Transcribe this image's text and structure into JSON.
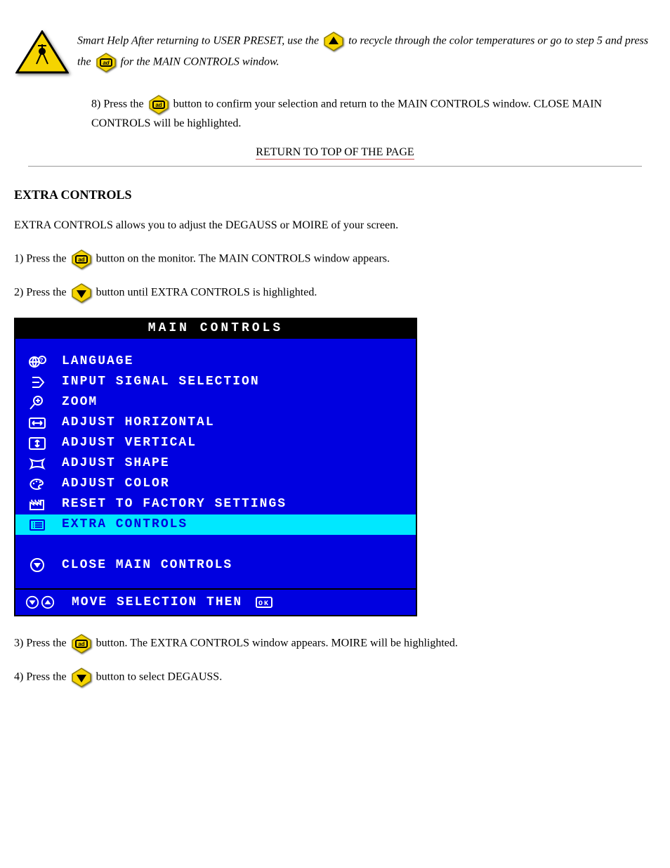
{
  "block1": {
    "smart_help_text_a": "Smart Help After returning to USER PRESET, use the ",
    "smart_help_text_b": " to recycle through the color temperatures or go to step 5 and press the ",
    "smart_help_text_c": " for the MAIN CONTROLS window."
  },
  "para2": {
    "a": "8) Press the ",
    "b": " button to confirm your selection and return to the MAIN CONTROLS window. CLOSE MAIN CONTROLS will be highlighted."
  },
  "center_link": "RETURN TO TOP OF THE PAGE",
  "section_title": "EXTRA CONTROLS",
  "intro_line": "EXTRA CONTROLS allows you to adjust the DEGAUSS or MOIRE of your screen.",
  "step1": {
    "a": "1) Press the ",
    "b": " button on the monitor. The MAIN CONTROLS window appears."
  },
  "step2": {
    "a": "2) Press the ",
    "b": " button until EXTRA CONTROLS is highlighted."
  },
  "osd": {
    "title": "MAIN CONTROLS",
    "items": [
      {
        "label": "LANGUAGE",
        "icon": "globe-question",
        "highlight": false
      },
      {
        "label": "INPUT SIGNAL SELECTION",
        "icon": "input-arrow",
        "highlight": false
      },
      {
        "label": "ZOOM",
        "icon": "magnifier-plus",
        "highlight": false
      },
      {
        "label": "ADJUST HORIZONTAL",
        "icon": "arrows-h-box",
        "highlight": false
      },
      {
        "label": "ADJUST VERTICAL",
        "icon": "arrows-v-box",
        "highlight": false
      },
      {
        "label": "ADJUST SHAPE",
        "icon": "pincushion-box",
        "highlight": false
      },
      {
        "label": "ADJUST COLOR",
        "icon": "palette",
        "highlight": false
      },
      {
        "label": "RESET TO FACTORY SETTINGS",
        "icon": "factory",
        "highlight": false
      },
      {
        "label": "EXTRA CONTROLS",
        "icon": "list-box",
        "highlight": true
      }
    ],
    "close_label": "CLOSE MAIN CONTROLS",
    "footer_label": "MOVE SELECTION THEN"
  },
  "step3": {
    "a": "3) Press the ",
    "b": " button. The EXTRA CONTROLS window appears. MOIRE will be highlighted."
  },
  "step4": {
    "a": "4) Press the ",
    "b": " button to select DEGAUSS."
  }
}
